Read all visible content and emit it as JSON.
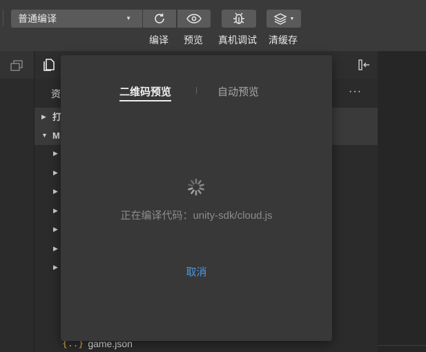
{
  "toolbar": {
    "mode_select_value": "普通编译",
    "compile_label": "编译",
    "preview_label": "预览",
    "debug_label": "真机调试",
    "cache_label": "清缓存"
  },
  "explorer": {
    "tab_label": "资",
    "more_label": "···",
    "tree": [
      {
        "label": "打",
        "expanded": false
      },
      {
        "label": "M",
        "expanded": true
      }
    ],
    "file": {
      "icon": "{..}",
      "name": "game.json"
    }
  },
  "modal": {
    "tab_active": "二维码预览",
    "tab_inactive": "自动预览",
    "status_text": "正在编译代码：unity-sdk/cloud.js",
    "cancel_label": "取消"
  },
  "colors": {
    "accent": "#4d97e0",
    "json_icon": "#e2b340"
  }
}
